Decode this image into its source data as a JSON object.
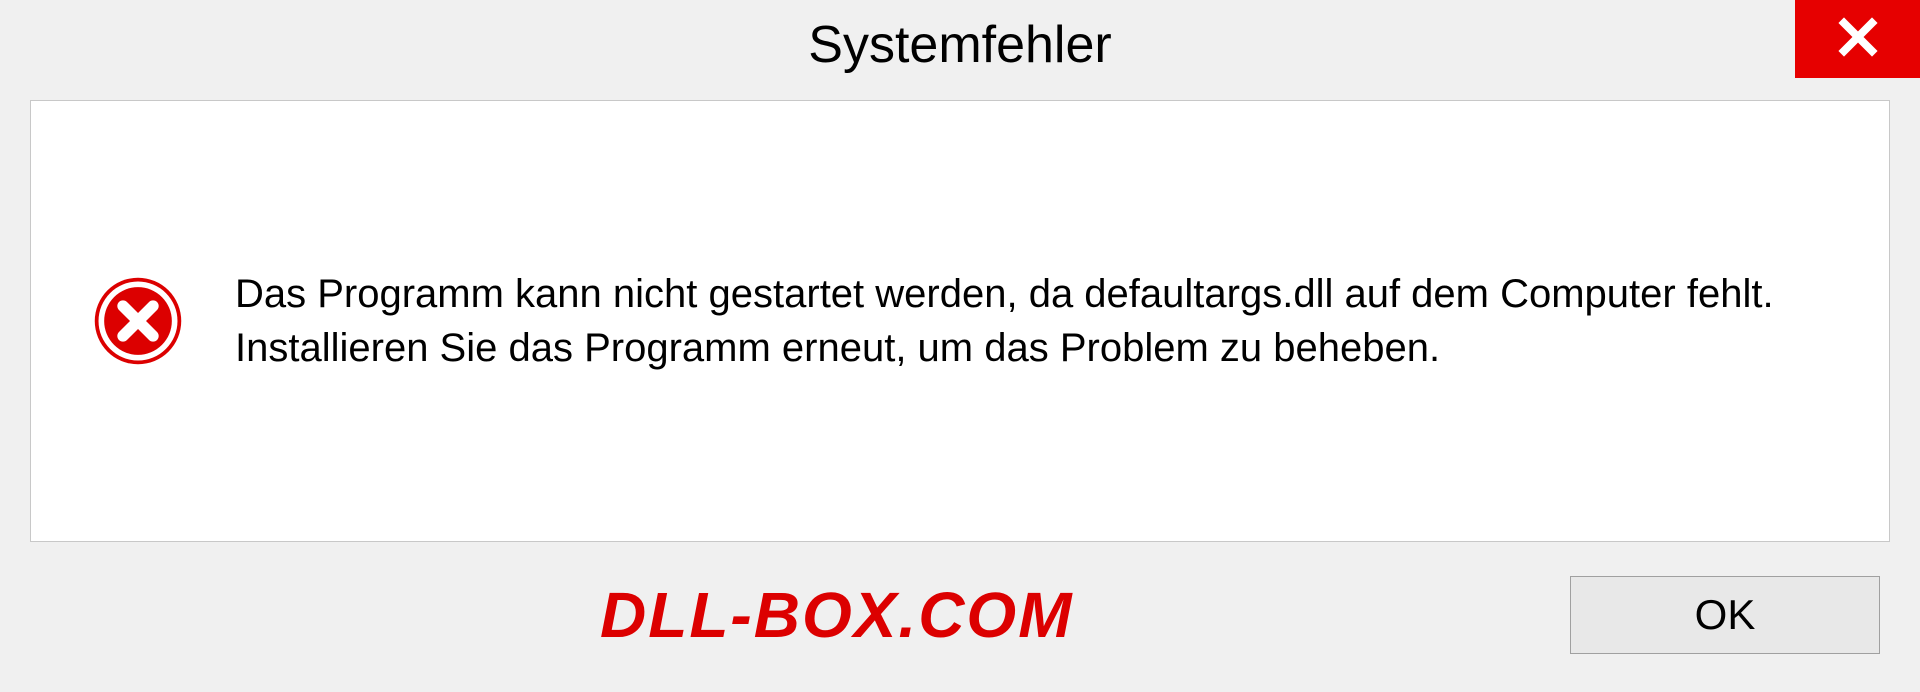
{
  "dialog": {
    "title": "Systemfehler",
    "message": "Das Programm kann nicht gestartet werden, da defaultargs.dll auf dem Computer fehlt. Installieren Sie das Programm erneut, um das Problem zu beheben.",
    "ok_label": "OK"
  },
  "watermark": "DLL-BOX.COM",
  "colors": {
    "close_bg": "#e60000",
    "error_icon": "#dc0000",
    "watermark": "#dc0000"
  }
}
